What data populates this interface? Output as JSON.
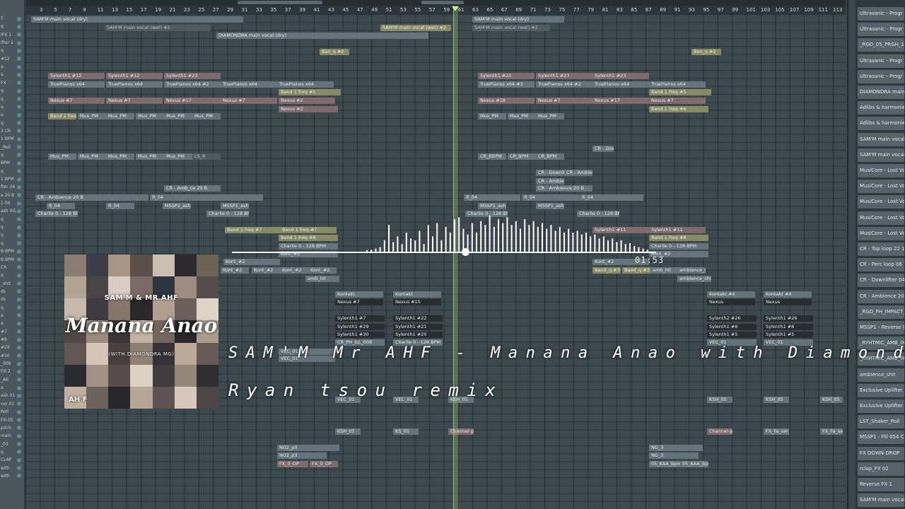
{
  "ruler": {
    "bars": [
      "3",
      "5",
      "7",
      "9",
      "11",
      "13",
      "15",
      "17",
      "19",
      "21",
      "23",
      "25",
      "27",
      "29",
      "31",
      "33",
      "35",
      "37",
      "39",
      "41",
      "43",
      "45",
      "47",
      "49",
      "51",
      "53",
      "55",
      "57",
      "59",
      "61",
      "63",
      "65",
      "67",
      "69",
      "71",
      "73",
      "75",
      "77",
      "79",
      "81",
      "83",
      "85",
      "87",
      "89",
      "91",
      "93",
      "95",
      "97",
      "99",
      "101",
      "103",
      "105",
      "107",
      "109",
      "111",
      "113"
    ]
  },
  "left_strip": {
    "labels": [
      "T",
      "q",
      "IFX 1",
      "ifter 2",
      "q",
      "#12",
      "a",
      "a",
      "FX",
      "q",
      "q",
      "q",
      "a",
      "q",
      "3 CR",
      "1 BPM",
      "_Roll",
      "q",
      "BPM",
      "q",
      "1 BPM",
      "fter 04",
      "e 20 B",
      "1 04",
      "ash 002",
      "q",
      "q",
      "q",
      "q",
      "B BPM",
      "B BPM",
      "CR",
      "q",
      "_shit",
      "ds",
      "ds",
      "q",
      "a",
      "a",
      "#7",
      "#8",
      "#29",
      "#30",
      "_008",
      "Fill 2",
      "_AR",
      "a",
      "ash 01",
      "ver 01",
      "Roll",
      "Fill 05",
      "pitch",
      "main",
      "_03",
      "q",
      "CLAP",
      "with",
      "with"
    ]
  },
  "clips": [
    {
      "label": "SAM'M main vocal (dry)",
      "style": "grey"
    },
    {
      "label": "SAM'M main vocal (wet) #2",
      "style": "dark"
    },
    {
      "label": "DIAMONDRA main vocal (dry)",
      "style": "grey"
    },
    {
      "label": "SAM'M main vocal (wet) #2",
      "style": "olive"
    },
    {
      "label": "SAM'M main vocal (dry)",
      "style": "grey"
    },
    {
      "label": "SAM'M main vocal (wet) #2",
      "style": "dark"
    },
    {
      "label": "Ban_q #2",
      "style": "olive"
    },
    {
      "label": "Ban_q #2",
      "style": "olive"
    },
    {
      "label": "Sylenth1 #12",
      "style": "mauve"
    },
    {
      "label": "Sylenth1 #12",
      "style": "mauve"
    },
    {
      "label": "Sylenth1 #23",
      "style": "mauve"
    },
    {
      "label": "Sylenth1 #25",
      "style": "mauve"
    },
    {
      "label": "Sylenth1 #23",
      "style": "mauve"
    },
    {
      "label": "Sylenth1 #23",
      "style": "mauve"
    },
    {
      "label": "TruePianos x64",
      "style": "grey"
    },
    {
      "label": "TruePianos x64",
      "style": "grey"
    },
    {
      "label": "TruePianos x64 #2",
      "style": "grey"
    },
    {
      "label": "TruePianos x64",
      "style": "grey"
    },
    {
      "label": "TruePianos x64",
      "style": "grey"
    },
    {
      "label": "TruePianos x64 #3",
      "style": "grey"
    },
    {
      "label": "TruePianos x64 #2",
      "style": "grey"
    },
    {
      "label": "TruePianos x64",
      "style": "grey"
    },
    {
      "label": "TruePianos x64",
      "style": "grey"
    },
    {
      "label": "Band 1 freq #5",
      "style": "olive"
    },
    {
      "label": "Band 1 freq #5",
      "style": "olive"
    },
    {
      "label": "Nexus #7",
      "style": "mauve"
    },
    {
      "label": "Nexus #7",
      "style": "mauve"
    },
    {
      "label": "Nexus #17",
      "style": "mauve"
    },
    {
      "label": "Nexus #7",
      "style": "mauve"
    },
    {
      "label": "Nexus #2",
      "style": "mauve"
    },
    {
      "label": "Nexus #18",
      "style": "mauve"
    },
    {
      "label": "Nexus #7",
      "style": "mauve"
    },
    {
      "label": "Nexus #17",
      "style": "mauve"
    },
    {
      "label": "Nexus #7",
      "style": "mauve"
    },
    {
      "label": "Nexus #2",
      "style": "mauve"
    },
    {
      "label": "Band 1 freq #6",
      "style": "olive"
    },
    {
      "label": "Band 1 freq #6",
      "style": "olive"
    },
    {
      "label": "Mus_PM",
      "style": "grey"
    },
    {
      "label": "Mus_PM",
      "style": "grey"
    },
    {
      "label": "Mus_PM",
      "style": "grey"
    },
    {
      "label": "Mus_PM",
      "style": "grey"
    },
    {
      "label": "Mus_PM",
      "style": "grey"
    },
    {
      "label": "Mus_PM",
      "style": "grey"
    },
    {
      "label": "Mus_PM",
      "style": "grey"
    },
    {
      "label": "Mus_PM",
      "style": "grey"
    },
    {
      "label": "Mus_PM",
      "style": "grey"
    },
    {
      "label": "Mus_PM",
      "style": "grey"
    },
    {
      "label": "Mus_PM",
      "style": "grey"
    },
    {
      "label": "Mus_PM",
      "style": "grey"
    },
    {
      "label": "Mus_PM",
      "style": "grey"
    },
    {
      "label": "LS_8",
      "style": "dark"
    },
    {
      "label": "CR_BBPM",
      "style": "grey"
    },
    {
      "label": "CR_BPM",
      "style": "grey"
    },
    {
      "label": "CR_BPM",
      "style": "grey"
    },
    {
      "label": "CR - Downlifter 04",
      "style": "grey"
    },
    {
      "label": "CR - Downlifter 04",
      "style": "grey"
    },
    {
      "label": "CR - Ambience 20 B",
      "style": "grey"
    },
    {
      "label": "CR - Ambience 20 B",
      "style": "grey"
    },
    {
      "label": "CR - Amb_ce 20 B",
      "style": "grey"
    },
    {
      "label": "CR - Ambience 20 B",
      "style": "grey"
    },
    {
      "label": "CR - Ambience 20 B",
      "style": "grey"
    },
    {
      "label": "R_04",
      "style": "grey"
    },
    {
      "label": "R_04",
      "style": "grey"
    },
    {
      "label": "R_04",
      "style": "grey"
    },
    {
      "label": "R_04",
      "style": "grey"
    },
    {
      "label": "R_04",
      "style": "grey"
    },
    {
      "label": "R_04",
      "style": "grey"
    },
    {
      "label": "MSSP1_ash 002",
      "style": "grey"
    },
    {
      "label": "MSSP1_ash 002",
      "style": "grey"
    },
    {
      "label": "MSSP1_ash 002",
      "style": "grey"
    },
    {
      "label": "MSSP1_ash 002",
      "style": "grey"
    },
    {
      "label": "Charlie 0 - 128 BPM #2",
      "style": "grey"
    },
    {
      "label": "Charlie 0 - 128 BPM #2",
      "style": "grey"
    },
    {
      "label": "Charlie 0 - 128 BPM #2",
      "style": "grey"
    },
    {
      "label": "Charlie 0 - 128 BPM #2",
      "style": "grey"
    },
    {
      "label": "Band 1 freq #7",
      "style": "olive"
    },
    {
      "label": "Band 1 freq #7",
      "style": "olive"
    },
    {
      "label": "Sylenth1 #11",
      "style": "mauve"
    },
    {
      "label": "Sylenth1 #11",
      "style": "mauve"
    },
    {
      "label": "Band 1 freq #8",
      "style": "olive"
    },
    {
      "label": "Band 1 freq #8",
      "style": "olive"
    },
    {
      "label": "Charlie 0 - 128 BPM",
      "style": "grey"
    },
    {
      "label": "Charlie 0 - 128 BPM",
      "style": "grey"
    },
    {
      "label": "Kont_#2",
      "style": "grey"
    },
    {
      "label": "Kont_#2",
      "style": "grey"
    },
    {
      "label": "Kont_#2",
      "style": "grey"
    },
    {
      "label": "Kont_#2",
      "style": "grey"
    },
    {
      "label": "Kont_#2",
      "style": "grey"
    },
    {
      "label": "Kont_#2",
      "style": "grey"
    },
    {
      "label": "Kont_#2",
      "style": "grey"
    },
    {
      "label": "Kont_#2",
      "style": "grey"
    },
    {
      "label": "Band_q #3",
      "style": "olive"
    },
    {
      "label": "Band_q #3",
      "style": "olive"
    },
    {
      "label": "amb_hit",
      "style": "grey"
    },
    {
      "label": "ambience_shit",
      "style": "grey"
    },
    {
      "label": "amb_hit",
      "style": "grey"
    },
    {
      "label": "ambience_shit",
      "style": "grey"
    },
    {
      "label": "Kontakt",
      "style": "grey"
    },
    {
      "label": "Kontakt",
      "style": "grey"
    },
    {
      "label": "Kontakt #4",
      "style": "grey"
    },
    {
      "label": "Kontakt #4",
      "style": "grey"
    },
    {
      "label": "Nexus #7",
      "style": "black"
    },
    {
      "label": "Nexus #15",
      "style": "black"
    },
    {
      "label": "Nexus",
      "style": "black"
    },
    {
      "label": "Nexus",
      "style": "black"
    },
    {
      "label": "Sylenth1 #7",
      "style": "black"
    },
    {
      "label": "Sylenth1 #22",
      "style": "black"
    },
    {
      "label": "Sylenth2 #26",
      "style": "black"
    },
    {
      "label": "Sylenth1 #26",
      "style": "black"
    },
    {
      "label": "Sylenth1 #29",
      "style": "black"
    },
    {
      "label": "Sylenth1 #21",
      "style": "black"
    },
    {
      "label": "Sylenth1 #6",
      "style": "black"
    },
    {
      "label": "Sylenth1 #6",
      "style": "black"
    },
    {
      "label": "Sylenth1 #30",
      "style": "black"
    },
    {
      "label": "Sylenth1 #20",
      "style": "black"
    },
    {
      "label": "Sylenth1 #5",
      "style": "black"
    },
    {
      "label": "Sylenth1 #5",
      "style": "black"
    },
    {
      "label": "CR_PH_ILL_008",
      "style": "grey"
    },
    {
      "label": "Charlie 0 - 128 BPM",
      "style": "grey"
    },
    {
      "label": "VEC_01",
      "style": "grey"
    },
    {
      "label": "VEC_01",
      "style": "grey"
    },
    {
      "label": "VEC_01",
      "style": "grey"
    },
    {
      "label": "VEC_01",
      "style": "grey"
    },
    {
      "label": "VEC_01",
      "style": "grey"
    },
    {
      "label": "VEC_01",
      "style": "grey"
    },
    {
      "label": "KSH_05",
      "style": "grey"
    },
    {
      "label": "KSH_05",
      "style": "grey"
    },
    {
      "label": "KSH_05",
      "style": "grey"
    },
    {
      "label": "KSH_05",
      "style": "grey"
    },
    {
      "label": "KSH_05",
      "style": "grey"
    },
    {
      "label": "KS_05",
      "style": "grey"
    },
    {
      "label": "Channel-pitch",
      "style": "mauve"
    },
    {
      "label": "Channel-pitch",
      "style": "mauve"
    },
    {
      "label": "FX_Fa_ser_01",
      "style": "grey"
    },
    {
      "label": "FX_Fa_ser_01",
      "style": "grey"
    },
    {
      "label": "NG2_p3",
      "style": "grey"
    },
    {
      "label": "NG_3",
      "style": "grey"
    },
    {
      "label": "NG2_p3",
      "style": "grey"
    },
    {
      "label": "NG_3",
      "style": "grey"
    },
    {
      "label": "FX_0_OP",
      "style": "mauve"
    },
    {
      "label": "FX_0_OP",
      "style": "mauve"
    },
    {
      "label": "05_KAA_bpm1",
      "style": "grey"
    },
    {
      "label": "05_KAA_bpm1",
      "style": "grey"
    }
  ],
  "right_panel": {
    "items": [
      "Ultrasonic - Progr",
      "Ultrasonic - Progr",
      "_RGD_05_PRGH_12",
      "Ultrasonic - Progr",
      "Ultrasonic - Progr",
      "DIAMONDRA main v",
      "Adlibs & harmonie",
      "Adlibs & harmonie",
      "SAM'M main vocal",
      "SAM'M main vocal",
      "MusiCore - Lost Vo",
      "MusiCore - Lost Vo",
      "MusiCore - Lost Vo",
      "MusiCore - Lost Vo",
      "MusiCore - Lost Vo",
      "CR - Top loop 22 1",
      "CR - Perc loop 06 1",
      "CR - Downlifter 04",
      "CR - Ambience 20 B",
      "_RGD_PH_IMPACT_",
      "MSSP1 - Reverse U",
      "_RYHTMIC_AMB_00",
      "_RYHTMIC_AMB_00",
      "ambience_shit",
      "Exclusive Uplifter 1",
      "Exclusive Uplifter 1",
      "LST_Shaker_Roll",
      "MSSP1 - Fill 054 Cl",
      "FX DOWN DROP",
      "rclap_FX 02",
      "Reverse FX 1",
      "SAM'M main vocal"
    ]
  },
  "album": {
    "top_text": "SAM'M & MR AHF",
    "title": "Manana Anao",
    "subtitle": "(WITH DIAMONDRA MG)",
    "logo": "AH F",
    "tile_colors": [
      "#8a7d74",
      "#3b3e49",
      "#a89585",
      "#5c4f4a",
      "#cbbfb3",
      "#2e2a2d",
      "#6f6358",
      "#b6a493",
      "#4a4348",
      "#d8cdc2",
      "#7a6a66",
      "#2f3441",
      "#9e8c80",
      "#574c4b",
      "#c7b8aa",
      "#3d3a3f",
      "#86766c",
      "#2a2729",
      "#b29f90",
      "#6b5f5b",
      "#e0d4c8",
      "#514746",
      "#9a8a7f",
      "#3a3537",
      "#c4b2a4",
      "#75675f",
      "#29272b",
      "#ad9c8e",
      "#625653",
      "#d3c6b9",
      "#483f3f",
      "#8f8075",
      "#363136",
      "#bba897",
      "#675b56",
      "#2c2a2e",
      "#a39283",
      "#574d4b",
      "#dcd0c3",
      "#433b3c",
      "#958678",
      "#312d31",
      "#c0ae9f",
      "#6e625c",
      "#282629",
      "#b7a595",
      "#5e5350",
      "#d6c9bc",
      "#4e4545"
    ]
  },
  "overlay": {
    "title": "SAM'M  Mr AHF - Manana Anao  with Diamondra MG",
    "subtitle": "Ryan tsou remix"
  },
  "visualizer": {
    "time": "01:53",
    "progress": 0.55,
    "bars": [
      0.04,
      0.05,
      0.08,
      0.12,
      0.3,
      0.7,
      0.25,
      0.4,
      0.2,
      0.5,
      0.35,
      0.3,
      0.55,
      0.2,
      0.7,
      0.4,
      0.75,
      0.3,
      0.65,
      0.5,
      0.85,
      0.9,
      0.6,
      0.45,
      0.75,
      0.5,
      0.8,
      0.7,
      0.95,
      0.65,
      0.85,
      0.75,
      0.9,
      0.7,
      0.8,
      0.6,
      0.85,
      0.7,
      0.8,
      0.65,
      0.75,
      0.6,
      0.7,
      0.55,
      0.65,
      0.5,
      0.6,
      0.5,
      0.55,
      0.45,
      0.5,
      0.4,
      0.45,
      0.35,
      0.4,
      0.3,
      0.35,
      0.25,
      0.3,
      0.2,
      0.22,
      0.15,
      0.12,
      0.08,
      0.05
    ]
  },
  "colors": {
    "grid_bg": "#3d494e",
    "clip_grey": "#65737a",
    "clip_olive": "#878a63",
    "clip_mauve": "#7f6a6d",
    "playhead": "#c8e6a0"
  }
}
